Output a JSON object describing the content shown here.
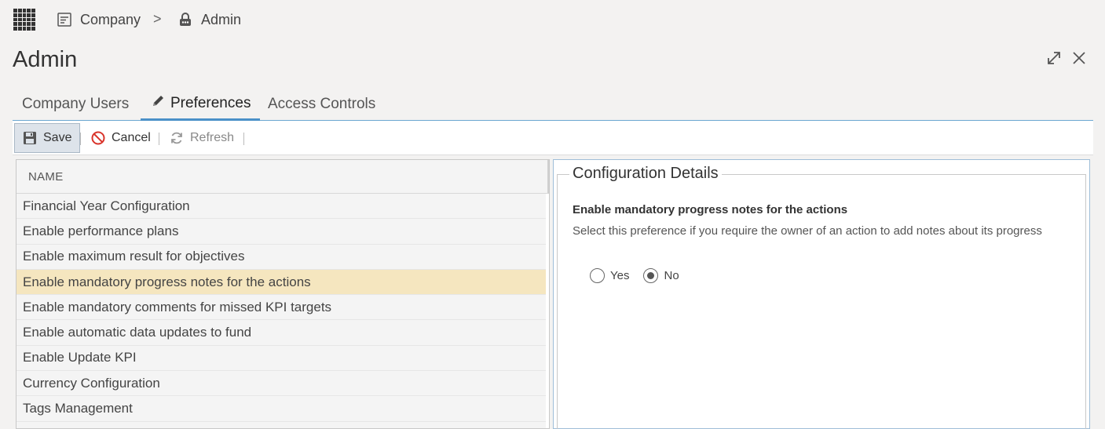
{
  "breadcrumb": {
    "company_label": "Company",
    "separator": ">",
    "admin_label": "Admin"
  },
  "page": {
    "title": "Admin"
  },
  "tabs": [
    {
      "label": "Company Users"
    },
    {
      "label": "Preferences"
    },
    {
      "label": "Access Controls"
    }
  ],
  "toolbar": {
    "save_label": "Save",
    "cancel_label": "Cancel",
    "refresh_label": "Refresh"
  },
  "list": {
    "header": "NAME",
    "items": [
      "Financial Year Configuration",
      "Enable performance plans",
      "Enable maximum result for objectives",
      "Enable mandatory progress notes for the actions",
      "Enable mandatory comments for missed KPI targets",
      "Enable automatic data updates to fund",
      "Enable Update KPI",
      "Currency Configuration",
      "Tags Management"
    ]
  },
  "detail": {
    "legend": "Configuration Details",
    "pref_title": "Enable mandatory progress notes for the actions",
    "pref_desc": "Select this preference if you require the owner of an action to add notes about its progress",
    "options": [
      {
        "label": "Yes"
      },
      {
        "label": "No"
      }
    ]
  }
}
